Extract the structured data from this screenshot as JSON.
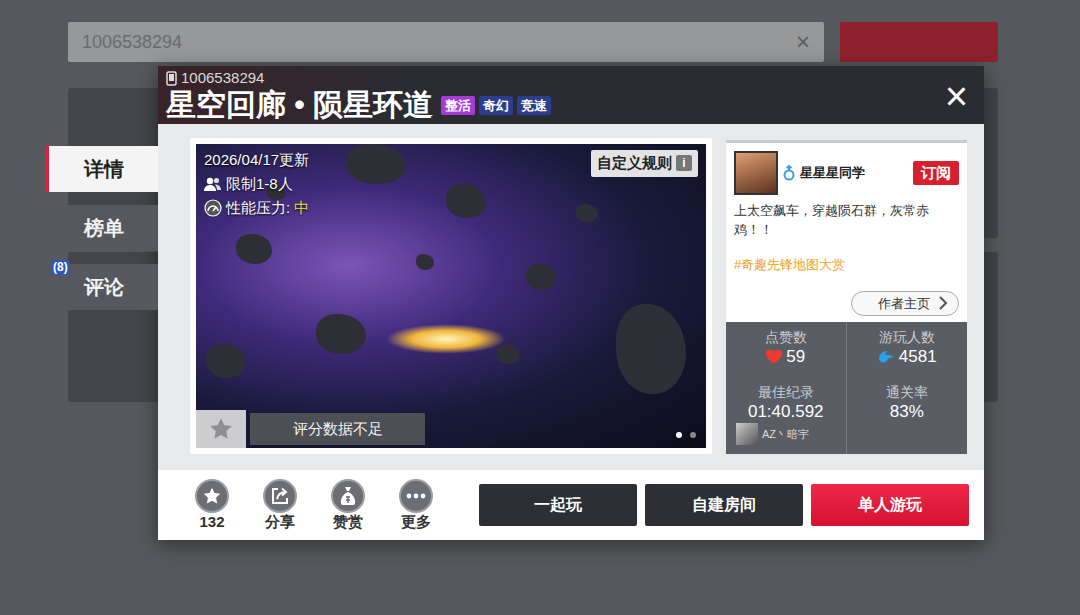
{
  "background": {
    "search_value": "1006538294",
    "clear": "×"
  },
  "side_tabs": [
    {
      "label": "详情",
      "selected": true
    },
    {
      "label": "榜单",
      "selected": false
    },
    {
      "label": "评论",
      "selected": false,
      "badge": "(8)"
    }
  ],
  "dialog": {
    "map_id": "1006538294",
    "title": "星空回廊 • 陨星环道",
    "tags": [
      {
        "label": "整活",
        "color": "#a43bd8"
      },
      {
        "label": "奇幻",
        "color": "#2c3c8e"
      },
      {
        "label": "竞速",
        "color": "#2c3c8e"
      }
    ],
    "close": "×"
  },
  "preview": {
    "updated": "2026/04/17更新",
    "players": "限制1-8人",
    "pressure_label": "性能压力:",
    "pressure_value": "中",
    "rule_button": "自定义规则",
    "rule_info": "i",
    "rating": "评分数据不足",
    "pages": [
      {
        "selected": true
      },
      {
        "selected": false
      }
    ]
  },
  "author": {
    "name": "星星星同学",
    "subscribe": "订阅",
    "description": "上太空飙车，穿越陨石群，灰常赤鸡！！",
    "hashtag": "#奇趣先锋地图大赏",
    "homepage": "作者主页"
  },
  "stats": [
    {
      "label": "点赞数",
      "value": "59",
      "kind": "likes"
    },
    {
      "label": "游玩人数",
      "value": "4581",
      "kind": "plays"
    },
    {
      "label": "最佳纪录",
      "value": "01:40.592",
      "holder": "AZ丶暗宇",
      "kind": "record"
    },
    {
      "label": "通关率",
      "value": "83%",
      "kind": "plain"
    }
  ],
  "actions": [
    {
      "label": "132",
      "kind": "favorite"
    },
    {
      "label": "分享",
      "kind": "share"
    },
    {
      "label": "赞赏",
      "kind": "reward"
    },
    {
      "label": "更多",
      "kind": "more"
    }
  ],
  "buttons": [
    {
      "label": "一起玩",
      "kind": "dark"
    },
    {
      "label": "自建房间",
      "kind": "dark"
    },
    {
      "label": "单人游玩",
      "kind": "primary"
    }
  ]
}
